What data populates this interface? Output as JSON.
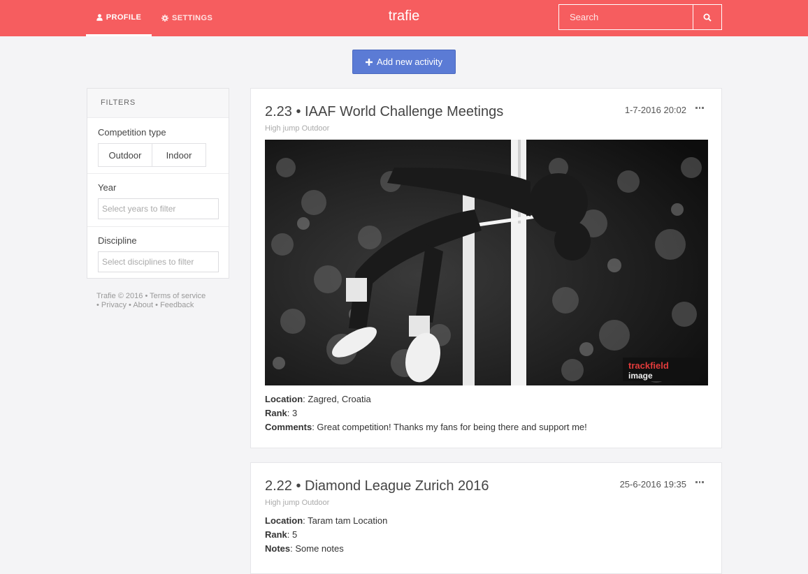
{
  "nav": {
    "tabs": [
      {
        "label": "PROFILE",
        "icon": "user-icon"
      },
      {
        "label": "SETTINGS",
        "icon": "gear-icon"
      }
    ],
    "brand": "trafie",
    "search": {
      "placeholder": "Search",
      "icon": "search-icon"
    }
  },
  "add_button": {
    "label": "Add new activity",
    "icon": "plus-icon"
  },
  "filters": {
    "header": "FILTERS",
    "competition_type": {
      "label": "Competition type",
      "options": [
        "Outdoor",
        "Indoor"
      ]
    },
    "year": {
      "label": "Year",
      "placeholder": "Select years to filter"
    },
    "discipline": {
      "label": "Discipline",
      "placeholder": "Select disciplines to filter"
    }
  },
  "footer": {
    "copyright": "Trafie © 2016",
    "links": [
      "Terms of service",
      "Privacy",
      "About",
      "Feedback"
    ]
  },
  "activities": [
    {
      "title": "2.23 • IAAF World Challenge Meetings",
      "subtitle": "High jump Outdoor",
      "date": "1-7-2016 20:02",
      "image_watermark": "trackfield image",
      "details": [
        {
          "key": "Location",
          "value": "Zagred, Croatia"
        },
        {
          "key": "Rank",
          "value": "3"
        },
        {
          "key": "Comments",
          "value": "Great competition! Thanks my fans for being there and support me!"
        }
      ]
    },
    {
      "title": "2.22 • Diamond League Zurich 2016",
      "subtitle": "High jump Outdoor",
      "date": "25-6-2016 19:35",
      "details": [
        {
          "key": "Location",
          "value": "Taram tam Location"
        },
        {
          "key": "Rank",
          "value": "5"
        },
        {
          "key": "Notes",
          "value": "Some notes"
        }
      ]
    }
  ],
  "colors": {
    "navbar": "#f65d5f",
    "primary_button": "#5b7bd5",
    "background": "#f4f4f6"
  }
}
